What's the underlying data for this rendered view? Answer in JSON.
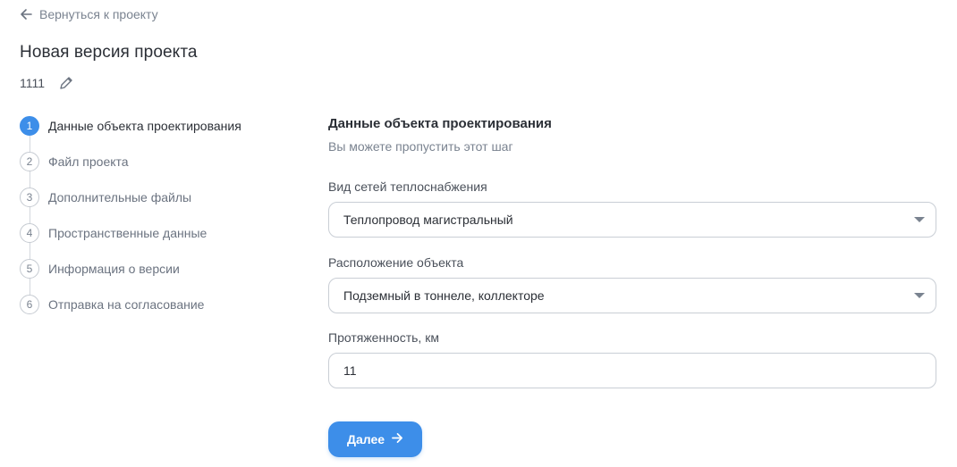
{
  "back_link": {
    "label": "Вернуться к проекту",
    "icon": "arrow-left-icon"
  },
  "page_title": "Новая версия проекта",
  "version": {
    "name": "1111",
    "icon": "pencil-icon"
  },
  "stepper": {
    "active_step": 1,
    "steps": [
      {
        "number": "1",
        "label": "Данные объекта проектирования"
      },
      {
        "number": "2",
        "label": "Файл проекта"
      },
      {
        "number": "3",
        "label": "Дополнительные файлы"
      },
      {
        "number": "4",
        "label": "Пространственные данные"
      },
      {
        "number": "5",
        "label": "Информация о версии"
      },
      {
        "number": "6",
        "label": "Отправка на согласование"
      }
    ]
  },
  "form": {
    "title": "Данные объекта проектирования",
    "subtitle": "Вы можете пропустить этот шаг",
    "network_type": {
      "label": "Вид сетей теплоснабжения",
      "value": "Теплопровод магистральный"
    },
    "location": {
      "label": "Расположение объекта",
      "value": "Подземный в тоннеле, коллекторе"
    },
    "length": {
      "label": "Протяженность, км",
      "value": "11"
    },
    "next_button": {
      "label": "Далее",
      "icon": "arrow-right-icon"
    }
  },
  "colors": {
    "accent": "#3d8ee9",
    "border": "#c9ced5",
    "muted_text": "#7a8390"
  }
}
